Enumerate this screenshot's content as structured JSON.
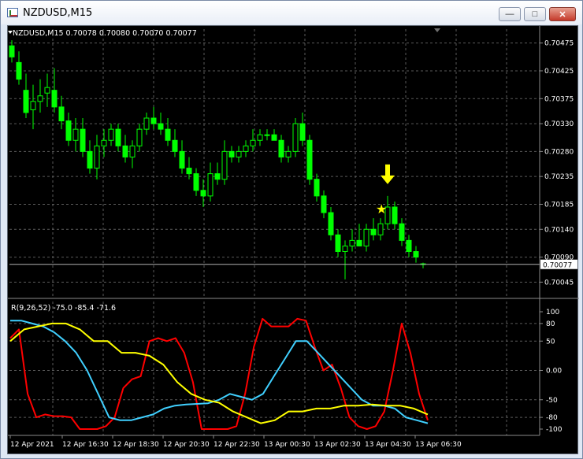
{
  "window": {
    "title": "NZDUSD,M15",
    "icon": "chart-app-icon",
    "minimize_icon": "minimize-icon",
    "maximize_icon": "maximize-icon",
    "close_icon": "close-icon"
  },
  "colors": {
    "background": "#000000",
    "grid": "#5a5a5a",
    "candle": "#00ff00",
    "axis_text": "#ffffff",
    "signal_line": "#ff0000",
    "cyan_line": "#40d0ff",
    "yellow_line": "#ffff00",
    "marker": "#ffff00"
  },
  "price_panel": {
    "header": "NZDUSD,M15  0.70078 0.70080 0.70070 0.70077",
    "y_ticks": [
      "0.70475",
      "0.70425",
      "0.70375",
      "0.70330",
      "0.70280",
      "0.70235",
      "0.70185",
      "0.70140",
      "0.70090",
      "0.70045"
    ],
    "current_price": "0.70077"
  },
  "indicator_panel": {
    "header": "R(9,26,52) -75.0 -85.4 -71.6",
    "y_ticks": [
      "100",
      "80",
      "50",
      "0.00",
      "-50",
      "-80",
      "-100"
    ]
  },
  "x_axis": {
    "labels": [
      "12 Apr 2021",
      "12 Apr 16:30",
      "12 Apr 18:30",
      "12 Apr 20:30",
      "12 Apr 22:30",
      "13 Apr 00:30",
      "13 Apr 02:30",
      "13 Apr 04:30",
      "13 Apr 06:30"
    ]
  },
  "chart_data": [
    {
      "type": "candlestick",
      "symbol": "NZDUSD",
      "timeframe": "M15",
      "ylim": [
        0.7002,
        0.705
      ],
      "ohlc": [
        [
          0.7047,
          0.7048,
          0.7044,
          0.7045
        ],
        [
          0.7044,
          0.7046,
          0.704,
          0.7041
        ],
        [
          0.7039,
          0.7042,
          0.7034,
          0.7035
        ],
        [
          0.70355,
          0.704,
          0.7032,
          0.7037
        ],
        [
          0.7037,
          0.7041,
          0.7035,
          0.7038
        ],
        [
          0.70385,
          0.7042,
          0.7036,
          0.70395
        ],
        [
          0.7039,
          0.7043,
          0.7035,
          0.7036
        ],
        [
          0.7036,
          0.7038,
          0.7032,
          0.70335
        ],
        [
          0.70335,
          0.7035,
          0.7029,
          0.703
        ],
        [
          0.703,
          0.7034,
          0.7028,
          0.7032
        ],
        [
          0.7032,
          0.7034,
          0.7027,
          0.7028
        ],
        [
          0.7028,
          0.703,
          0.7024,
          0.7025
        ],
        [
          0.7025,
          0.7031,
          0.7023,
          0.7029
        ],
        [
          0.7029,
          0.7032,
          0.7027,
          0.703
        ],
        [
          0.703,
          0.7033,
          0.7029,
          0.7032
        ],
        [
          0.7032,
          0.7033,
          0.7028,
          0.7029
        ],
        [
          0.7029,
          0.7031,
          0.7026,
          0.7027
        ],
        [
          0.7027,
          0.703,
          0.7025,
          0.7029
        ],
        [
          0.7029,
          0.7033,
          0.7028,
          0.7032
        ],
        [
          0.7032,
          0.7035,
          0.7031,
          0.7034
        ],
        [
          0.7034,
          0.7036,
          0.7032,
          0.7033
        ],
        [
          0.7033,
          0.7035,
          0.7031,
          0.7032
        ],
        [
          0.7032,
          0.7034,
          0.7029,
          0.703
        ],
        [
          0.703,
          0.7032,
          0.7027,
          0.7028
        ],
        [
          0.7028,
          0.703,
          0.7024,
          0.7025
        ],
        [
          0.7025,
          0.7027,
          0.7023,
          0.7024
        ],
        [
          0.7024,
          0.7025,
          0.702,
          0.7021
        ],
        [
          0.7021,
          0.7023,
          0.7018,
          0.702
        ],
        [
          0.702,
          0.7026,
          0.7019,
          0.7024
        ],
        [
          0.7024,
          0.7026,
          0.7022,
          0.7023
        ],
        [
          0.7023,
          0.703,
          0.7022,
          0.7028
        ],
        [
          0.7028,
          0.7029,
          0.7026,
          0.7027
        ],
        [
          0.7027,
          0.7029,
          0.7026,
          0.7028
        ],
        [
          0.7028,
          0.703,
          0.7027,
          0.7029
        ],
        [
          0.7029,
          0.7032,
          0.7028,
          0.703
        ],
        [
          0.703,
          0.7032,
          0.7029,
          0.7031
        ],
        [
          0.7031,
          0.7032,
          0.703,
          0.7031
        ],
        [
          0.7031,
          0.7032,
          0.703,
          0.703
        ],
        [
          0.703,
          0.7031,
          0.7026,
          0.7027
        ],
        [
          0.7027,
          0.7029,
          0.7026,
          0.7028
        ],
        [
          0.7028,
          0.7034,
          0.7027,
          0.7033
        ],
        [
          0.7033,
          0.7035,
          0.7029,
          0.703
        ],
        [
          0.703,
          0.7031,
          0.7022,
          0.7023
        ],
        [
          0.7023,
          0.7024,
          0.7019,
          0.702
        ],
        [
          0.702,
          0.7021,
          0.7016,
          0.7017
        ],
        [
          0.7017,
          0.7018,
          0.7012,
          0.7013
        ],
        [
          0.7013,
          0.7014,
          0.7009,
          0.701
        ],
        [
          0.701,
          0.7012,
          0.7005,
          0.7011
        ],
        [
          0.7011,
          0.7014,
          0.701,
          0.7012
        ],
        [
          0.7012,
          0.7015,
          0.7011,
          0.7011
        ],
        [
          0.7011,
          0.7015,
          0.701,
          0.7014
        ],
        [
          0.7014,
          0.7016,
          0.7012,
          0.7013
        ],
        [
          0.7013,
          0.7016,
          0.7012,
          0.7015
        ],
        [
          0.7015,
          0.702,
          0.7014,
          0.7018
        ],
        [
          0.7018,
          0.7019,
          0.7014,
          0.7015
        ],
        [
          0.7015,
          0.7016,
          0.7011,
          0.7012
        ],
        [
          0.7012,
          0.7013,
          0.7009,
          0.701
        ],
        [
          0.701,
          0.7011,
          0.7008,
          0.7009
        ],
        [
          0.70078,
          0.7008,
          0.7007,
          0.70077
        ]
      ],
      "markers": [
        {
          "type": "arrow-down",
          "index": 53
        },
        {
          "type": "star",
          "index": 52
        }
      ]
    },
    {
      "type": "line",
      "ylim": [
        -100,
        100
      ],
      "series": [
        {
          "color": "#ff0000",
          "values": [
            55,
            70,
            -40,
            -80,
            -75,
            -78,
            -78,
            -80,
            -100,
            -100,
            -100,
            -95,
            -80,
            -30,
            -15,
            -10,
            50,
            55,
            50,
            55,
            30,
            -20,
            -100,
            -100,
            -100,
            -100,
            -95,
            -40,
            40,
            88,
            75,
            75,
            75,
            88,
            85,
            40,
            0,
            10,
            -30,
            -80,
            -95,
            -100,
            -95,
            -70,
            0,
            80,
            30,
            -40,
            -85
          ]
        },
        {
          "color": "#40d0ff",
          "values": [
            85,
            85,
            80,
            75,
            65,
            50,
            30,
            0,
            -40,
            -80,
            -85,
            -85,
            -80,
            -75,
            -65,
            -60,
            -58,
            -57,
            -56,
            -50,
            -40,
            -45,
            -50,
            -40,
            -10,
            20,
            50,
            50,
            30,
            10,
            -10,
            -30,
            -50,
            -60,
            -60,
            -65,
            -80,
            -85,
            -90
          ]
        },
        {
          "color": "#ffff00",
          "values": [
            50,
            70,
            75,
            80,
            80,
            70,
            50,
            50,
            30,
            30,
            25,
            10,
            -20,
            -40,
            -50,
            -55,
            -70,
            -80,
            -90,
            -85,
            -70,
            -70,
            -65,
            -65,
            -60,
            -60,
            -58,
            -60,
            -60,
            -65,
            -75
          ]
        }
      ]
    }
  ]
}
